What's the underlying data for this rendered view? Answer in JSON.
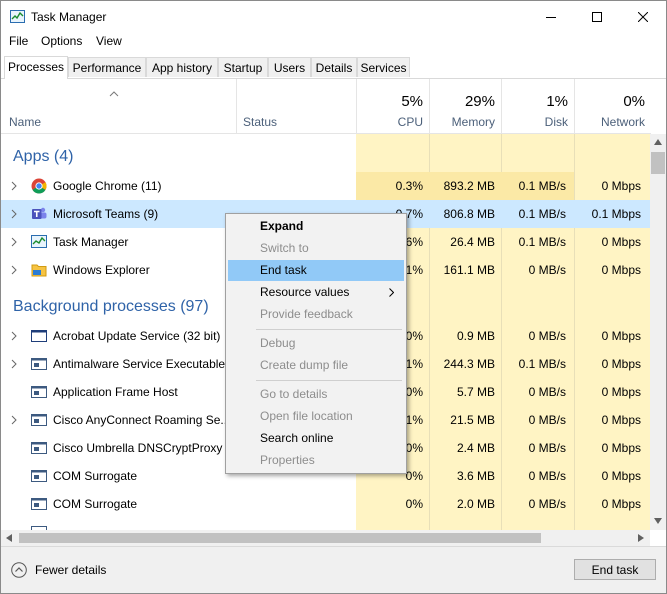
{
  "window": {
    "title": "Task Manager",
    "icon": "task-manager-icon"
  },
  "titlebar": {
    "minimize": "minimize-icon",
    "maximize": "maximize-icon",
    "close": "close-icon"
  },
  "menu": [
    "File",
    "Options",
    "View"
  ],
  "tabs": [
    "Processes",
    "Performance",
    "App history",
    "Startup",
    "Users",
    "Details",
    "Services"
  ],
  "header": {
    "name": "Name",
    "status": "Status",
    "cpu": {
      "pct": "5%",
      "label": "CPU"
    },
    "memory": {
      "pct": "29%",
      "label": "Memory"
    },
    "disk": {
      "pct": "1%",
      "label": "Disk"
    },
    "network": {
      "pct": "0%",
      "label": "Network"
    }
  },
  "groups": {
    "apps": "Apps (4)",
    "background": "Background processes (97)"
  },
  "rows": [
    {
      "name": "Google Chrome (11)",
      "icon": "chrome-icon",
      "expandable": true,
      "cpu": "0.3%",
      "memory": "893.2 MB",
      "disk": "0.1 MB/s",
      "network": "0 Mbps"
    },
    {
      "name": "Microsoft Teams (9)",
      "icon": "teams-icon",
      "expandable": true,
      "cpu": "0.7%",
      "memory": "806.8 MB",
      "disk": "0.1 MB/s",
      "network": "0.1 Mbps"
    },
    {
      "name": "Task Manager",
      "icon": "task-manager-icon",
      "expandable": true,
      "cpu": "0.6%",
      "memory": "26.4 MB",
      "disk": "0.1 MB/s",
      "network": "0 Mbps"
    },
    {
      "name": "Windows Explorer",
      "icon": "folder-icon",
      "expandable": true,
      "cpu": "0.1%",
      "memory": "161.1 MB",
      "disk": "0 MB/s",
      "network": "0 Mbps"
    },
    {
      "name": "Acrobat Update Service (32 bit)",
      "icon": "service-window-icon",
      "expandable": true,
      "cpu": "0%",
      "memory": "0.9 MB",
      "disk": "0 MB/s",
      "network": "0 Mbps"
    },
    {
      "name": "Antimalware Service Executable",
      "icon": "service-window-icon",
      "expandable": true,
      "cpu": "0.1%",
      "memory": "244.3 MB",
      "disk": "0.1 MB/s",
      "network": "0 Mbps"
    },
    {
      "name": "Application Frame Host",
      "icon": "service-window-icon",
      "expandable": false,
      "cpu": "0%",
      "memory": "5.7 MB",
      "disk": "0 MB/s",
      "network": "0 Mbps"
    },
    {
      "name": "Cisco AnyConnect Roaming Se...",
      "icon": "service-window-icon",
      "expandable": true,
      "cpu": "0.1%",
      "memory": "21.5 MB",
      "disk": "0 MB/s",
      "network": "0 Mbps"
    },
    {
      "name": "Cisco Umbrella DNSCryptProxy ...",
      "icon": "service-window-icon",
      "expandable": false,
      "cpu": "0%",
      "memory": "2.4 MB",
      "disk": "0 MB/s",
      "network": "0 Mbps"
    },
    {
      "name": "COM Surrogate",
      "icon": "service-window-icon",
      "expandable": false,
      "cpu": "0%",
      "memory": "3.6 MB",
      "disk": "0 MB/s",
      "network": "0 Mbps"
    },
    {
      "name": "COM Surrogate",
      "icon": "service-window-icon",
      "expandable": false,
      "cpu": "0%",
      "memory": "2.0 MB",
      "disk": "0 MB/s",
      "network": "0 Mbps"
    }
  ],
  "context_menu": [
    {
      "label": "Expand",
      "enabled": true,
      "bold": true
    },
    {
      "label": "Switch to",
      "enabled": false
    },
    {
      "label": "End task",
      "enabled": true,
      "highlighted": true
    },
    {
      "label": "Resource values",
      "enabled": true,
      "submenu": true
    },
    {
      "label": "Provide feedback",
      "enabled": false
    },
    {
      "label": "Debug",
      "enabled": false
    },
    {
      "label": "Create dump file",
      "enabled": false
    },
    {
      "label": "Go to details",
      "enabled": false
    },
    {
      "label": "Open file location",
      "enabled": false
    },
    {
      "label": "Search online",
      "enabled": true
    },
    {
      "label": "Properties",
      "enabled": false
    }
  ],
  "footer": {
    "fewer_details": "Fewer details",
    "end_task": "End task"
  },
  "colors": {
    "heat": "#fff4c4",
    "selected_row": "#cce8ff",
    "highlight": "#91c9f7",
    "group_text": "#2f63a8"
  }
}
